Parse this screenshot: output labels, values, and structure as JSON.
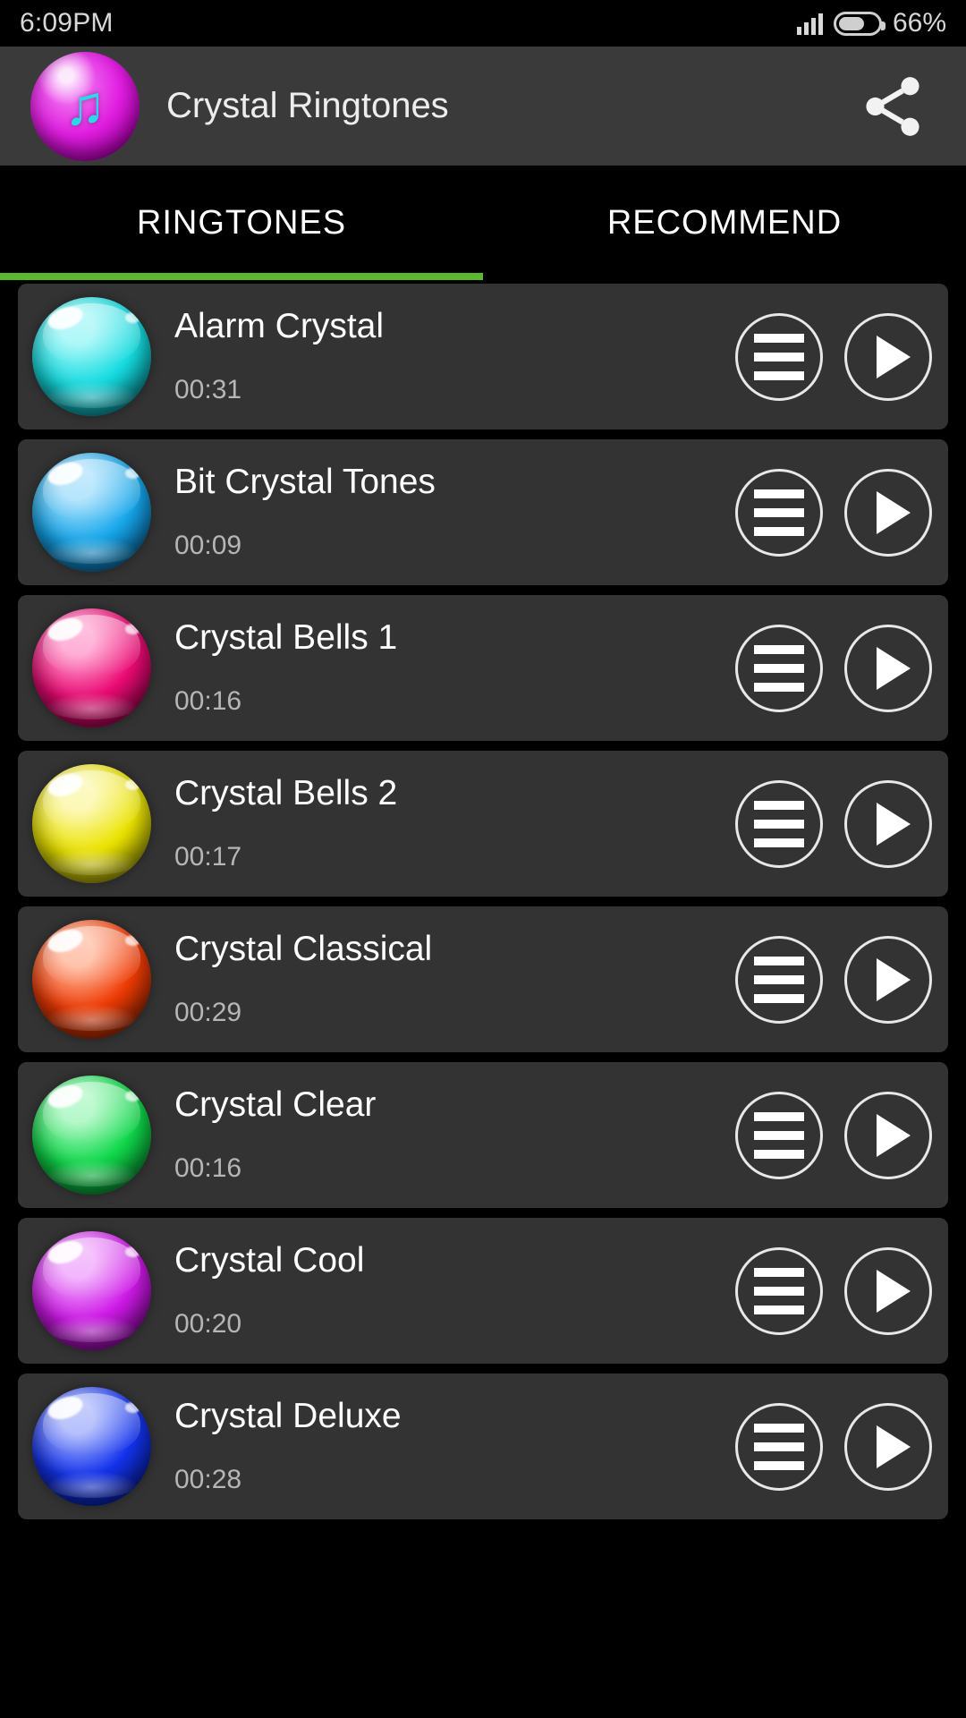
{
  "status_bar": {
    "time": "6:09PM",
    "battery_percent": "66%",
    "signal_icon": "signal-bars-icon",
    "battery_icon": "battery-icon"
  },
  "app_bar": {
    "title": "Crystal Ringtones",
    "logo_icon": "music-note-logo-icon",
    "logo_glyph": "♫",
    "share_icon": "share-icon",
    "logo_color": "#e01fe0",
    "note_color": "#29d9e8",
    "background": "#3a3a3a"
  },
  "tabs": {
    "items": [
      {
        "label": "RINGTONES",
        "active": true
      },
      {
        "label": "RECOMMEND",
        "active": false
      }
    ],
    "indicator_color": "#5cb82e"
  },
  "list": {
    "menu_icon": "menu-list-icon",
    "play_icon": "play-icon",
    "items": [
      {
        "title": "Alarm Crystal",
        "duration": "00:31",
        "color": "#15dce0",
        "color_dark": "#047e86",
        "color_light": "#9ff6f7"
      },
      {
        "title": "Bit Crystal Tones",
        "duration": "00:09",
        "color": "#17a8ec",
        "color_dark": "#065b91",
        "color_light": "#a8e0fb"
      },
      {
        "title": "Crystal Bells 1",
        "duration": "00:16",
        "color": "#ec0b75",
        "color_dark": "#8e0045",
        "color_light": "#ff9ecd"
      },
      {
        "title": "Crystal Bells 2",
        "duration": "00:17",
        "color": "#ece400",
        "color_dark": "#8d8a00",
        "color_light": "#fbf7a6"
      },
      {
        "title": "Crystal Classical",
        "duration": "00:29",
        "color": "#f03c05",
        "color_dark": "#8f2200",
        "color_light": "#ffb79c"
      },
      {
        "title": "Crystal Clear",
        "duration": "00:16",
        "color": "#10d94b",
        "color_dark": "#05822b",
        "color_light": "#a7f7bf"
      },
      {
        "title": "Crystal Cool",
        "duration": "00:20",
        "color": "#cf1ae8",
        "color_dark": "#7a058c",
        "color_light": "#efa8fb"
      },
      {
        "title": "Crystal Deluxe",
        "duration": "00:28",
        "color": "#1433ee",
        "color_dark": "#061a8e",
        "color_light": "#a7b4fb"
      }
    ]
  }
}
